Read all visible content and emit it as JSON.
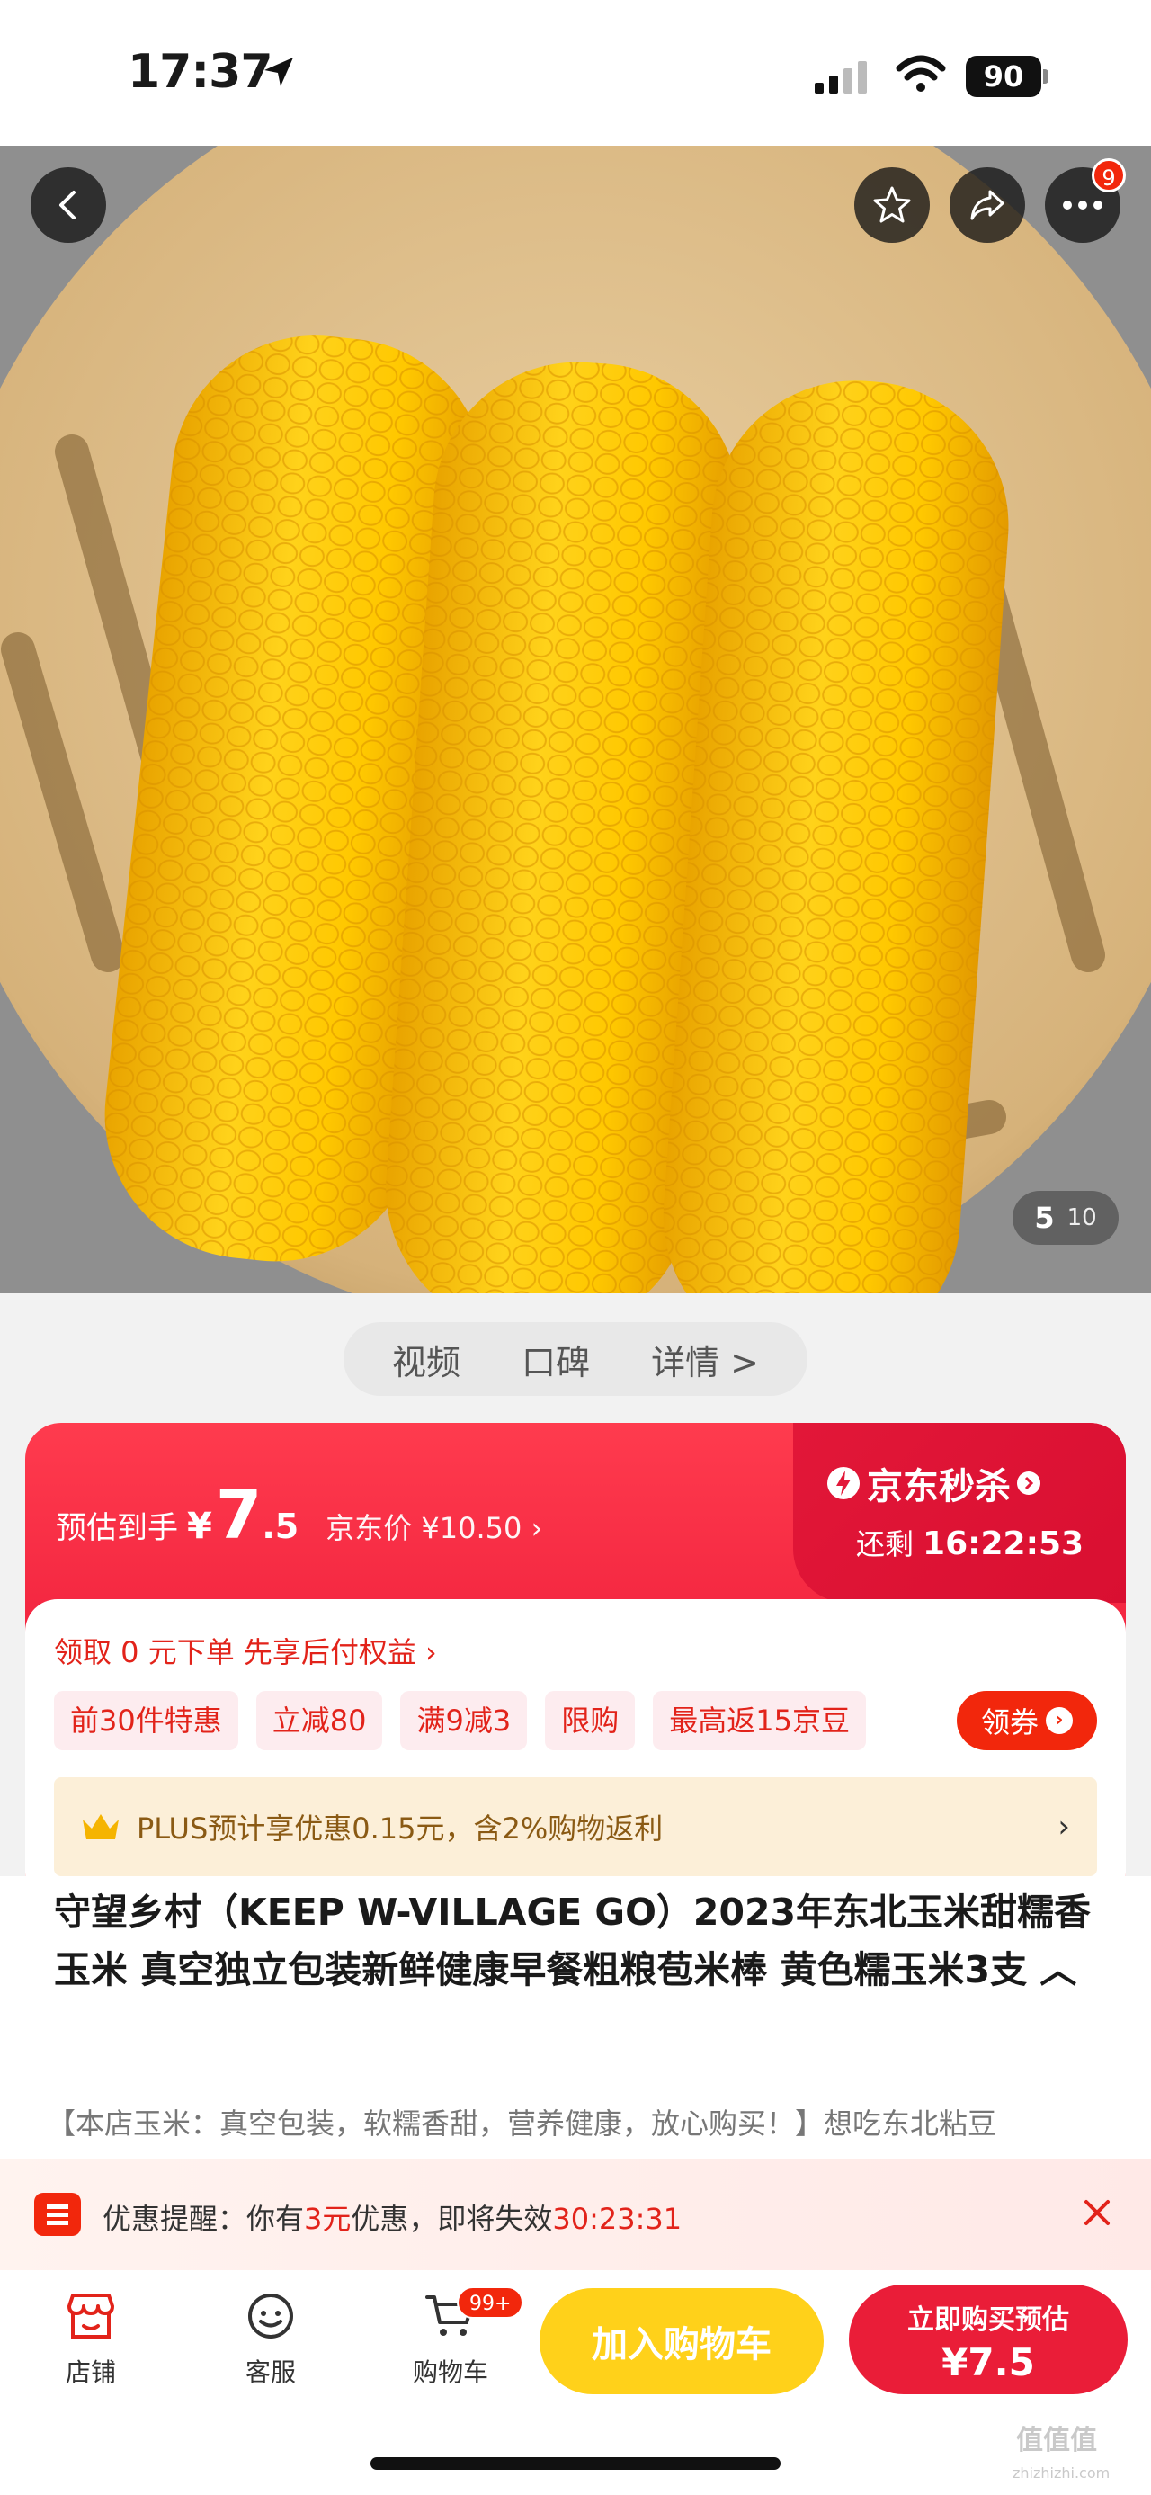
{
  "status_bar": {
    "time": "17:37",
    "battery": "90"
  },
  "gallery": {
    "current": "5",
    "total": "10",
    "cart_badge": "9"
  },
  "tabs": [
    "视频",
    "口碑",
    "详情 >"
  ],
  "price": {
    "est_label": "预估到手",
    "currency": "¥",
    "integer": "7",
    "decimal": ".5",
    "jd_price": "京东价 ¥10.50 ›",
    "seckill_label": "京东秒杀",
    "remain_label": "还剩",
    "countdown": "16:22:53"
  },
  "pay_later": "领取 0 元下单 先享后付权益 ›",
  "promo_tags": [
    "前30件特惠",
    "立减80",
    "满9减3",
    "限购",
    "最高返15京豆"
  ],
  "coupon_button": "领券",
  "plus": {
    "text": "PLUS预计享优惠0.15元，含2%购物返利",
    "arrow": "›"
  },
  "product": {
    "title": "守望乡村（KEEP W-VILLAGE GO）2023年东北玉米甜糯香玉米 真空独立包装新鲜健康早餐粗粮苞米棒 黄色糯玉米3支 ︿",
    "description": "【本店玉米：真空包装，软糯香甜，营养健康，放心购买！】想吃东北粘豆"
  },
  "reminder": {
    "prefix": "优惠提醒：你有",
    "amount": "3元",
    "mid": "优惠，即将失效",
    "countdown": "30:23:31"
  },
  "bottom_nav": {
    "store": "店铺",
    "service": "客服",
    "cart": "购物车",
    "cart_badge": "99+",
    "add_to_cart": "加入购物车",
    "buy_line1": "立即购买预估",
    "buy_line2": "¥7.5"
  },
  "watermark": {
    "logo": "值值值",
    "url": "zhizhizhi.com"
  },
  "colors": {
    "jd_red": "#f2270c",
    "card_red": "#ee1d3a",
    "plus_gold": "#8a5a14",
    "add_cart_yellow": "#ffd11a"
  }
}
